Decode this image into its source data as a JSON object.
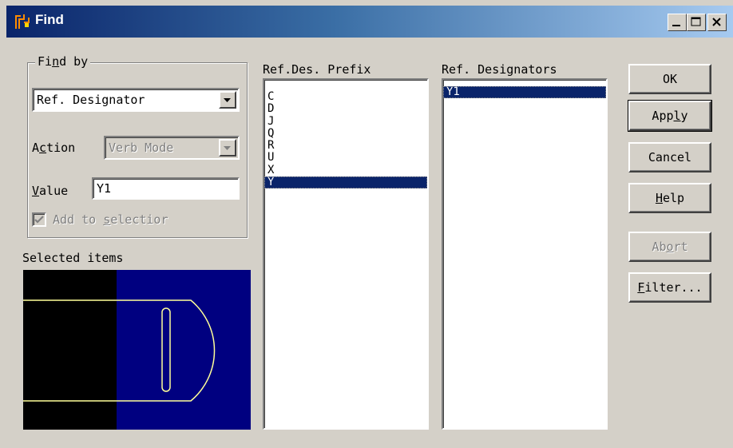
{
  "window": {
    "title": "Find",
    "minimize_glyph": "_",
    "maximize_glyph": "□",
    "close_glyph": "X"
  },
  "find_by": {
    "group_label_pre": "Fi",
    "group_label_key": "n",
    "group_label_post": "d by",
    "type_value": "Ref. Designator",
    "action_label_pre": "A",
    "action_label_key": "c",
    "action_label_post": "tion",
    "action_value": "Verb Mode",
    "value_label_key": "V",
    "value_label_post": "alue",
    "value_input": "Y1",
    "add_selection_pre": "Add to ",
    "add_selection_key": "s",
    "add_selection_post": "electior",
    "add_selection_checked": true
  },
  "selected_items_label": "Selected items",
  "prefix_list": {
    "header": "Ref.Des. Prefix",
    "items": [
      "C",
      "D",
      "J",
      "Q",
      "R",
      "U",
      "X",
      "Y"
    ],
    "selected": "Y"
  },
  "designators_list": {
    "header": "Ref. Designators",
    "items": [
      "Y1"
    ],
    "selected": "Y1"
  },
  "buttons": {
    "ok": "OK",
    "apply_pre": "App",
    "apply_key": "l",
    "apply_post": "y",
    "cancel": "Cancel",
    "help_key": "H",
    "help_post": "elp",
    "abort_pre": "Ab",
    "abort_key": "o",
    "abort_post": "rt",
    "filter_key": "F",
    "filter_post": "ilter..."
  },
  "colors": {
    "dialog_face": "#d4d0c8",
    "title_active": "#0a246a",
    "selection": "#0a246a",
    "preview_fill": "#000080",
    "preview_outline": "#ffff99"
  }
}
